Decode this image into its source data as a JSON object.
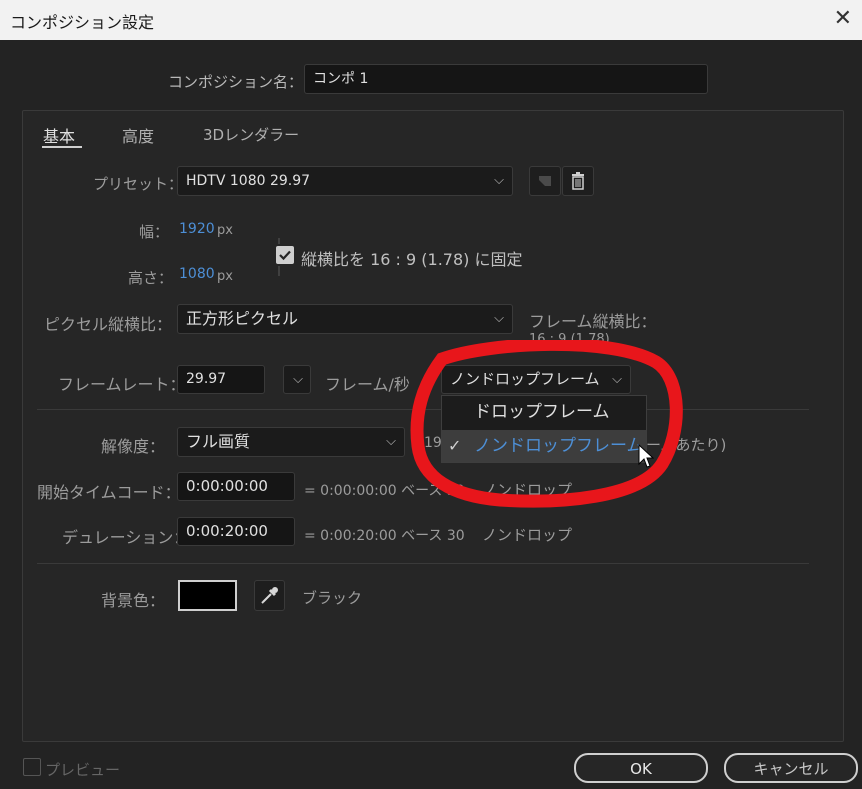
{
  "window": {
    "title": "コンポジション設定",
    "close_glyph": "✕"
  },
  "comp_name": {
    "label": "コンポジション名：",
    "value": "コンポ 1"
  },
  "tabs": [
    {
      "label": "基本"
    },
    {
      "label": "高度"
    },
    {
      "label": "3Dレンダラー"
    }
  ],
  "preset": {
    "label": "プリセット：",
    "value": "HDTV 1080 29.97"
  },
  "width": {
    "label": "幅：",
    "value": "1920",
    "unit": "px"
  },
  "height": {
    "label": "高さ：",
    "value": "1080",
    "unit": "px"
  },
  "lock_aspect": {
    "label": "縦横比を 16 : 9 (1.78) に固定",
    "checked": true
  },
  "pixel_aspect": {
    "label": "ピクセル縦横比：",
    "value": "正方形ピクセル"
  },
  "frame_aspect": {
    "label": "フレーム縦横比：",
    "value": "16 : 9 (1.78)"
  },
  "frame_rate": {
    "label": "フレームレート：",
    "value": "29.97",
    "unit": "フレーム/秒",
    "drop_value": "ノンドロップフレーム"
  },
  "drop_menu": {
    "items": [
      {
        "label": "ドロップフレーム",
        "checked": false
      },
      {
        "label": "ノンドロップフレーム",
        "checked": true
      }
    ]
  },
  "resolution": {
    "label": "解像度：",
    "value": "フル画質",
    "info_partial_left": "19",
    "info_partial_right": "ームあたり)"
  },
  "start_timecode": {
    "label": "開始タイムコード：",
    "value": "0:00:00:00",
    "info": "= 0:00:00:00  ベース 30",
    "mode": "ノンドロップ"
  },
  "duration": {
    "label": "デュレーション：",
    "value": "0:00:20:00",
    "info": "= 0:00:20:00  ベース 30",
    "mode": "ノンドロップ"
  },
  "background": {
    "label": "背景色：",
    "color_name": "ブラック",
    "swatch_color": "#000000"
  },
  "preview": {
    "label": "プレビュー",
    "checked": false
  },
  "buttons": {
    "ok": "OK",
    "cancel": "キャンセル"
  },
  "colors": {
    "accent_blue": "#4d8fd6",
    "annotation_red": "#e8161b"
  }
}
